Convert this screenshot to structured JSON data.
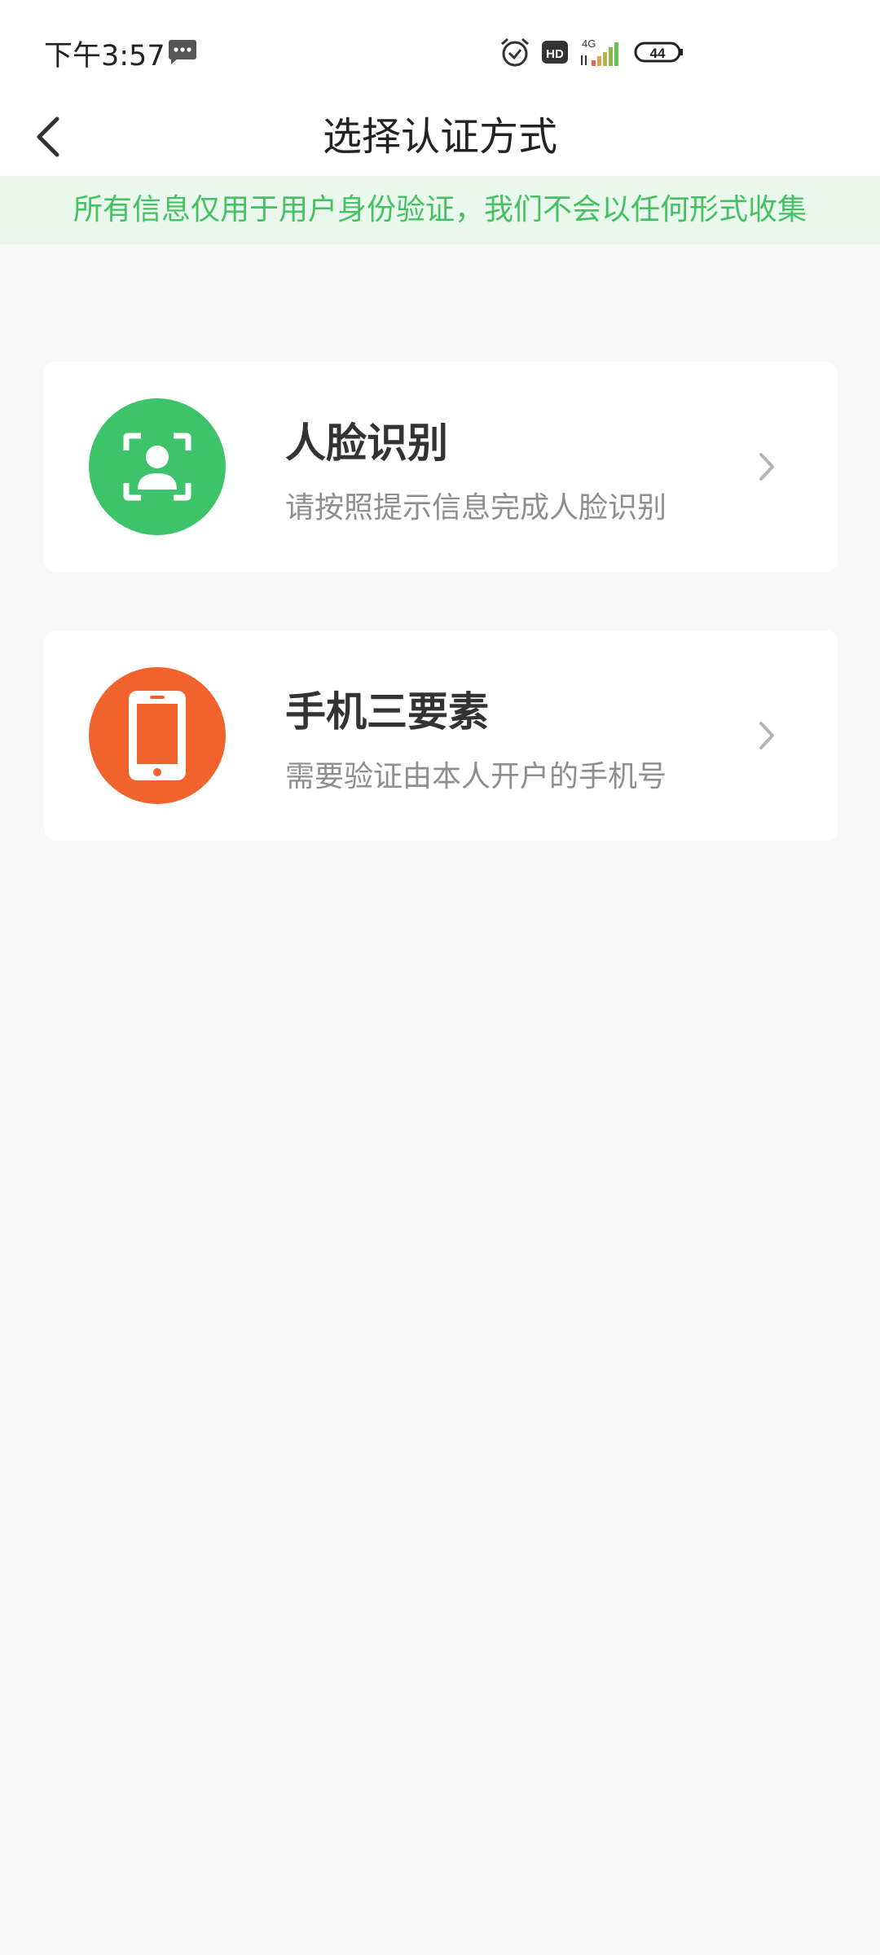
{
  "status_bar": {
    "time": "下午3:57",
    "icons": [
      "message-icon",
      "alarm-icon",
      "hd-icon",
      "signal-4g-icon",
      "battery-icon"
    ],
    "network": "4G",
    "battery": "44"
  },
  "header": {
    "title": "选择认证方式",
    "back_icon": "chevron-left-icon"
  },
  "notice": {
    "text": "所有信息仅用于用户身份验证，我们不会以任何形式收集",
    "color": "#45c163",
    "background": "#e9f7ec"
  },
  "methods": [
    {
      "title": "人脸识别",
      "subtitle": "请按照提示信息完成人脸识别",
      "icon": "face-scan-icon",
      "color": "#3dc46a"
    },
    {
      "title": "手机三要素",
      "subtitle": "需要验证由本人开户的手机号",
      "icon": "phone-icon",
      "color": "#f2622d"
    }
  ]
}
